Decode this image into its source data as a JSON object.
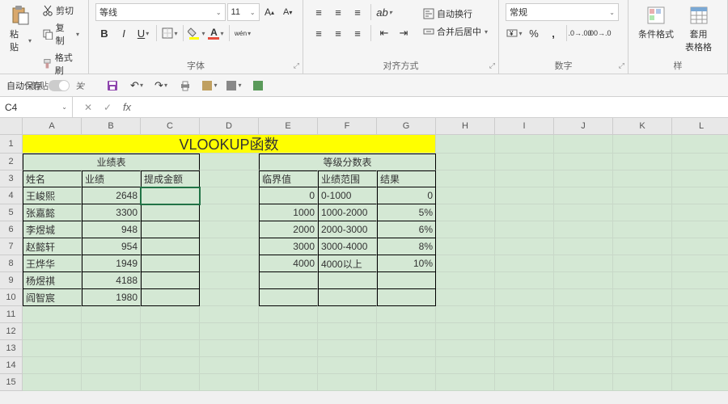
{
  "ribbon": {
    "clipboard": {
      "label": "剪贴板",
      "paste": "粘贴",
      "cut": "剪切",
      "copy": "复制",
      "format": "格式刷"
    },
    "font": {
      "label": "字体",
      "name": "等线",
      "size": "11"
    },
    "align": {
      "label": "对齐方式",
      "wrap": "自动换行",
      "merge": "合并后居中"
    },
    "number": {
      "label": "数字",
      "format": "常规"
    },
    "styles": {
      "label": "样",
      "cond": "条件格式",
      "tbl": "套用\n表格格"
    }
  },
  "qat": {
    "autosave": "自动保存",
    "off": "关"
  },
  "formula": {
    "cell": "C4"
  },
  "sheet": {
    "cols": [
      "A",
      "B",
      "C",
      "D",
      "E",
      "F",
      "G",
      "H",
      "I",
      "J",
      "K",
      "L"
    ],
    "rows": 15,
    "title": "VLOOKUP函数",
    "t1": {
      "title": "业绩表",
      "h": [
        "姓名",
        "业绩",
        "提成金额"
      ],
      "d": [
        [
          "王峻熙",
          "2648",
          ""
        ],
        [
          "张嘉懿",
          "3300",
          ""
        ],
        [
          "李煜城",
          "948",
          ""
        ],
        [
          "赵懿轩",
          "954",
          ""
        ],
        [
          "王烨华",
          "1949",
          ""
        ],
        [
          "杨煜祺",
          "4188",
          ""
        ],
        [
          "阎智宸",
          "1980",
          ""
        ]
      ]
    },
    "t2": {
      "title": "等级分数表",
      "h": [
        "临界值",
        "业绩范围",
        "结果"
      ],
      "d": [
        [
          "0",
          "0-1000",
          "0"
        ],
        [
          "1000",
          "1000-2000",
          "5%"
        ],
        [
          "2000",
          "2000-3000",
          "6%"
        ],
        [
          "3000",
          "3000-4000",
          "8%"
        ],
        [
          "4000",
          "4000以上",
          "10%"
        ]
      ]
    }
  }
}
